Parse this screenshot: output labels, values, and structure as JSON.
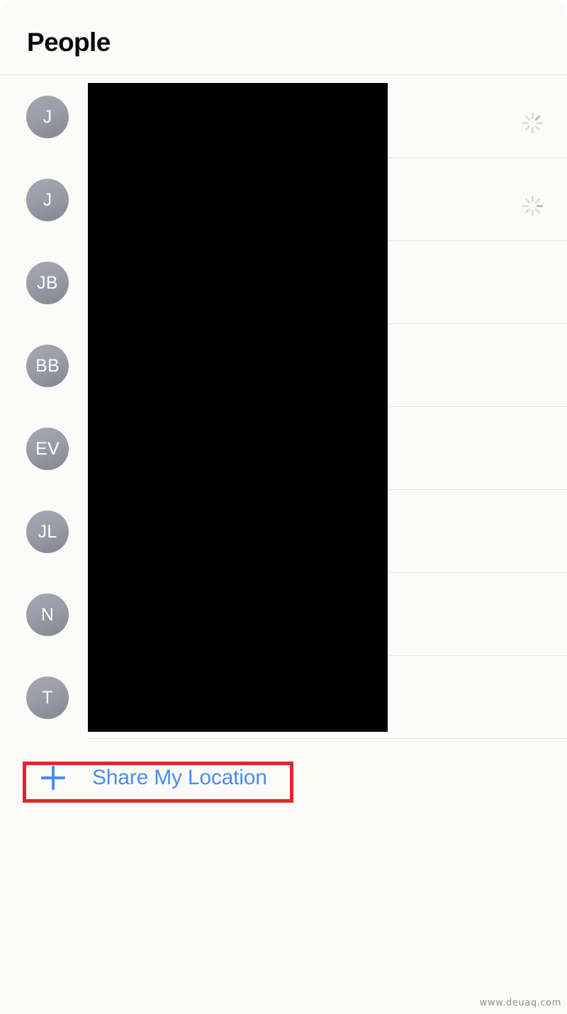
{
  "sheet": {
    "grabber": "sheet-grabber",
    "background_color": "#fbfbf9"
  },
  "header": {
    "title": "People",
    "separator": "header-separator"
  },
  "list": {
    "rows": [
      {
        "initials": "J",
        "status": "loading",
        "spinner": true
      },
      {
        "initials": "J",
        "status": "loading",
        "spinner": true
      },
      {
        "initials": "JB",
        "status": "",
        "spinner": false
      },
      {
        "initials": "BB",
        "status": "",
        "spinner": false
      },
      {
        "initials": "EV",
        "status": "",
        "spinner": false
      },
      {
        "initials": "JL",
        "status": "",
        "spinner": false
      },
      {
        "initials": "N",
        "status": "",
        "spinner": false
      },
      {
        "initials": "T",
        "status": "",
        "spinner": false
      }
    ]
  },
  "redaction": {
    "label": "redacted-names-block",
    "color": "#000000"
  },
  "share": {
    "label": "Share My Location",
    "icon": "plus-icon",
    "accent_color": "#4a8cf0"
  },
  "annotation": {
    "label": "highlight-box",
    "color": "#e0262c"
  },
  "watermark": {
    "text": "www.deuaq.com"
  }
}
